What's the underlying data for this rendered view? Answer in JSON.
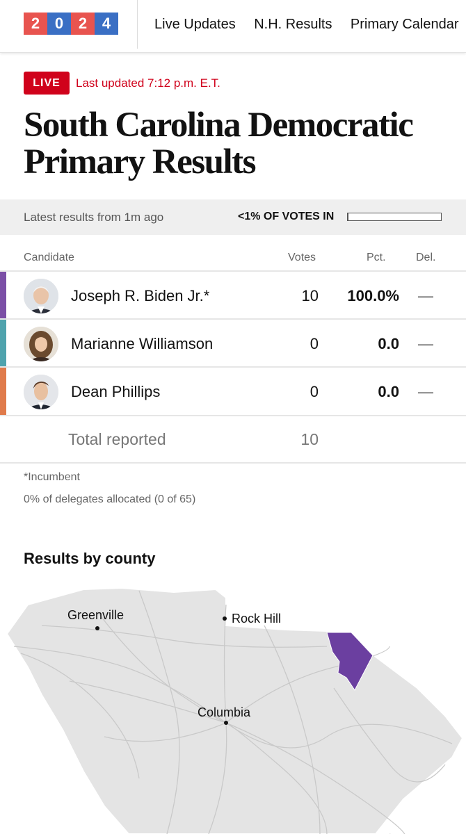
{
  "nav": {
    "logo_digits": [
      "2",
      "0",
      "2",
      "4"
    ],
    "logo_colors": [
      "#e8544f",
      "#3a6fc4",
      "#e8544f",
      "#3a6fc4"
    ],
    "links": [
      "Live Updates",
      "N.H. Results",
      "Primary Calendar"
    ]
  },
  "header": {
    "live_badge": "LIVE",
    "last_updated": "Last updated 7:12 p.m. E.T.",
    "title": "South Carolina Democratic Primary Results"
  },
  "status": {
    "latest": "Latest results from 1m ago",
    "votes_in": "<1% OF VOTES IN",
    "progress_fraction": 0.005
  },
  "table": {
    "headers": {
      "candidate": "Candidate",
      "votes": "Votes",
      "pct": "Pct.",
      "del": "Del."
    },
    "candidates": [
      {
        "name": "Joseph R. Biden Jr.*",
        "votes": "10",
        "pct": "100.0%",
        "del": "—",
        "color": "#7b4fa6"
      },
      {
        "name": "Marianne Williamson",
        "votes": "0",
        "pct": "0.0",
        "del": "—",
        "color": "#4fa3ad"
      },
      {
        "name": "Dean Phillips",
        "votes": "0",
        "pct": "0.0",
        "del": "—",
        "color": "#e07b4b"
      }
    ],
    "total_label": "Total reported",
    "total_votes": "10"
  },
  "notes": {
    "incumbent": "*Incumbent",
    "delegates": "0% of delegates allocated (0 of 65)"
  },
  "map": {
    "section_title": "Results by county",
    "cities": [
      "Greenville",
      "Rock Hill",
      "Columbia"
    ],
    "base_color": "#e4e4e4",
    "winner_color": "#6b3fa0"
  }
}
